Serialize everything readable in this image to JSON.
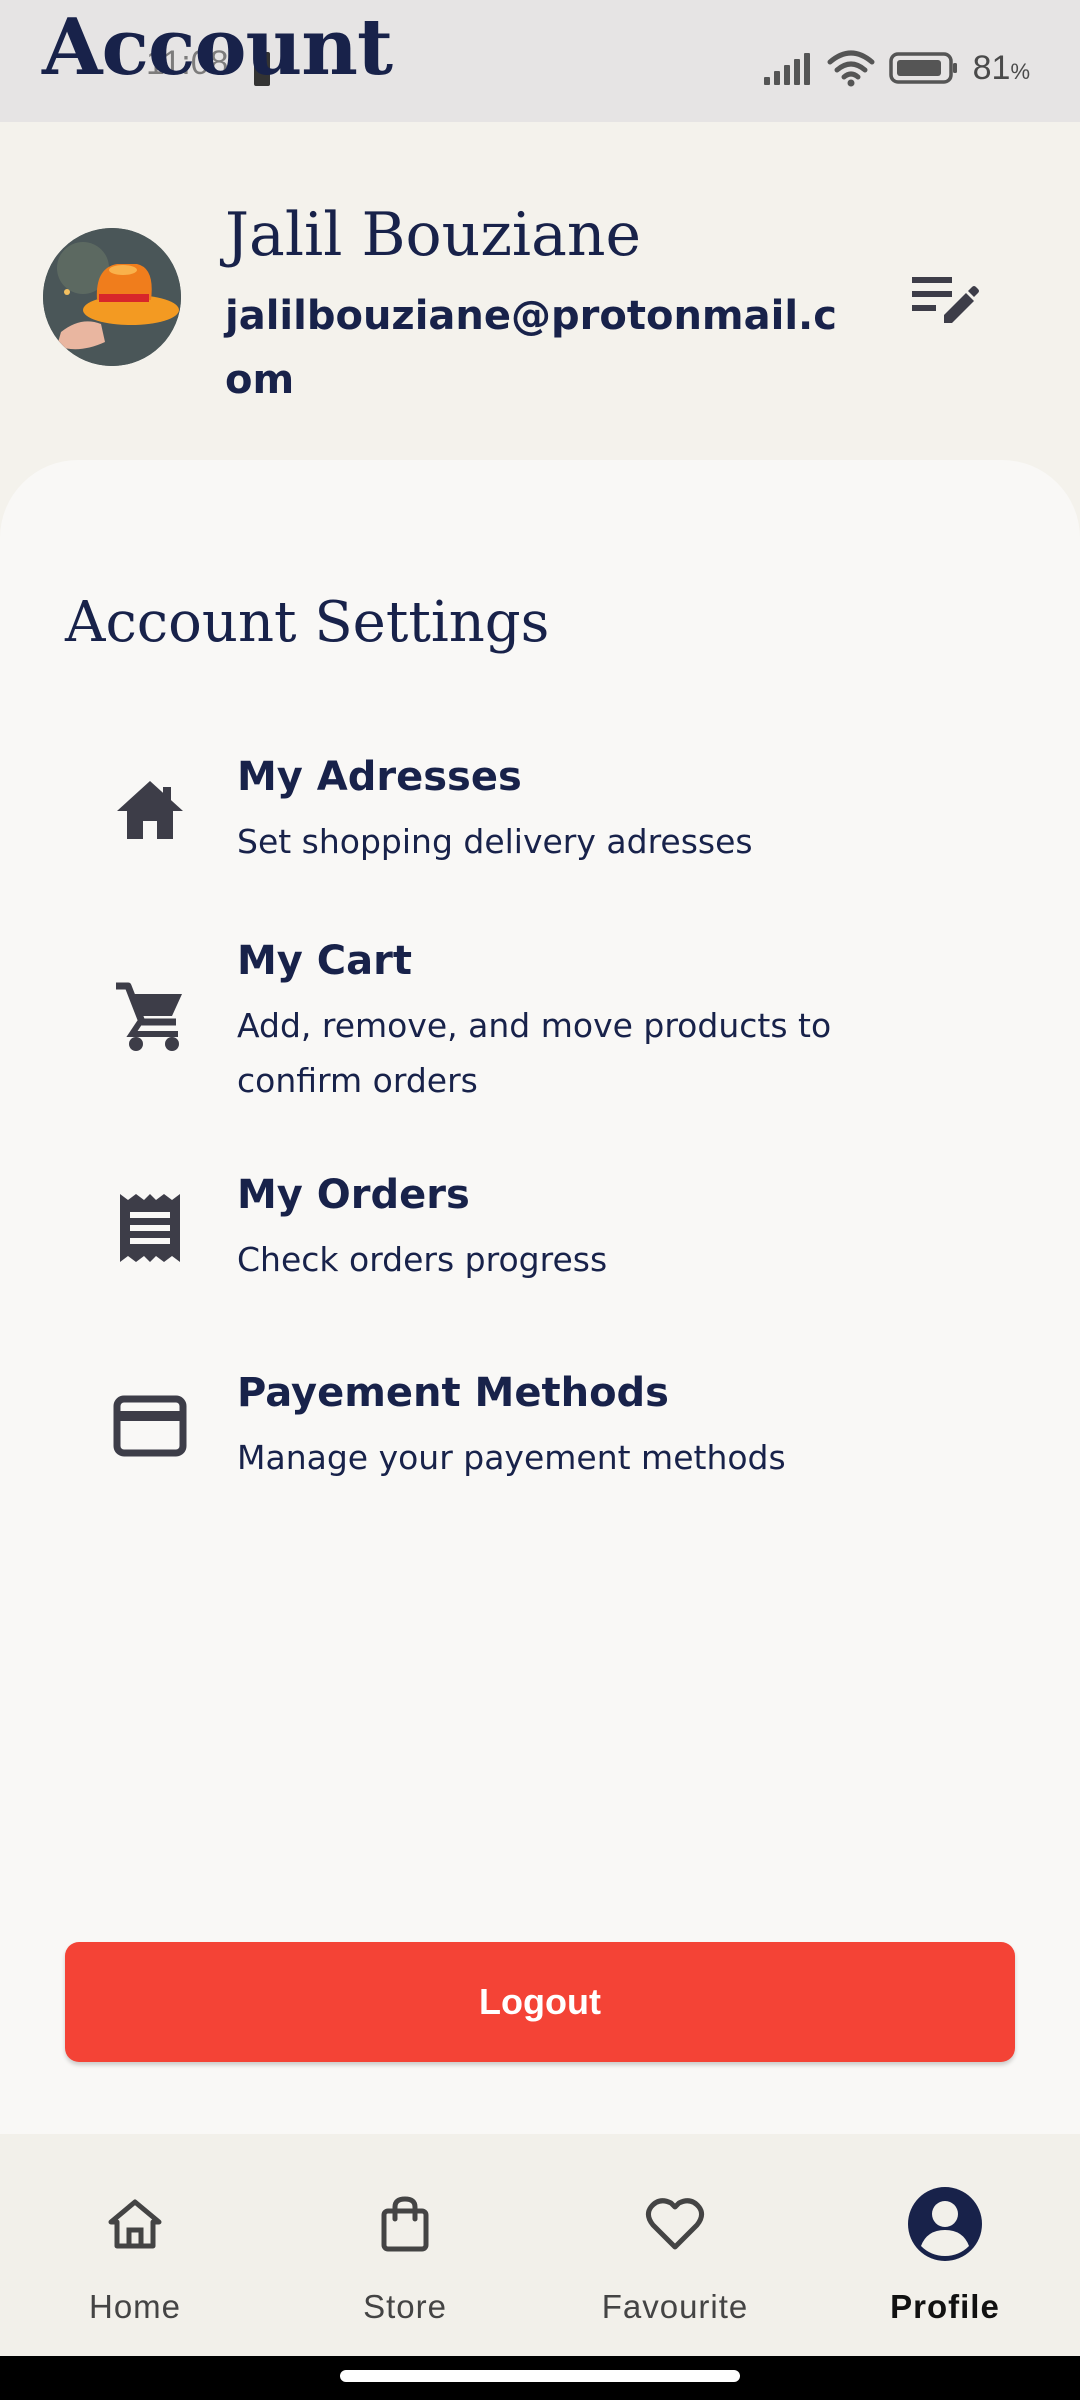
{
  "status_bar": {
    "time": "11:08",
    "battery": "81",
    "battery_unit": "%"
  },
  "header": {
    "title": "Account"
  },
  "profile": {
    "name": "Jalil Bouziane",
    "email": "jalilbouziane@protonmail.com",
    "edit_icon": "edit-list-icon"
  },
  "settings": {
    "title": "Account Settings",
    "items": [
      {
        "icon": "home-icon",
        "title": "My Adresses",
        "subtitle": "Set shopping delivery adresses"
      },
      {
        "icon": "cart-icon",
        "title": "My Cart",
        "subtitle": "Add, remove, and move products to confirm orders"
      },
      {
        "icon": "receipt-icon",
        "title": "My Orders",
        "subtitle": "Check orders progress"
      },
      {
        "icon": "credit-card-icon",
        "title": "Payement Methods",
        "subtitle": "Manage your payement methods"
      }
    ]
  },
  "logout": {
    "label": "Logout",
    "color": "#f44336"
  },
  "bottom_nav": {
    "active": "Profile",
    "items": [
      {
        "icon": "home-outline-icon",
        "label": "Home"
      },
      {
        "icon": "shopping-bag-icon",
        "label": "Store"
      },
      {
        "icon": "heart-icon",
        "label": "Favourite"
      },
      {
        "icon": "account-circle-icon",
        "label": "Profile"
      }
    ]
  },
  "colors": {
    "primary_text": "#18224a",
    "background": "#f4f2ec",
    "card": "#f9f8f6",
    "danger": "#f44336"
  }
}
